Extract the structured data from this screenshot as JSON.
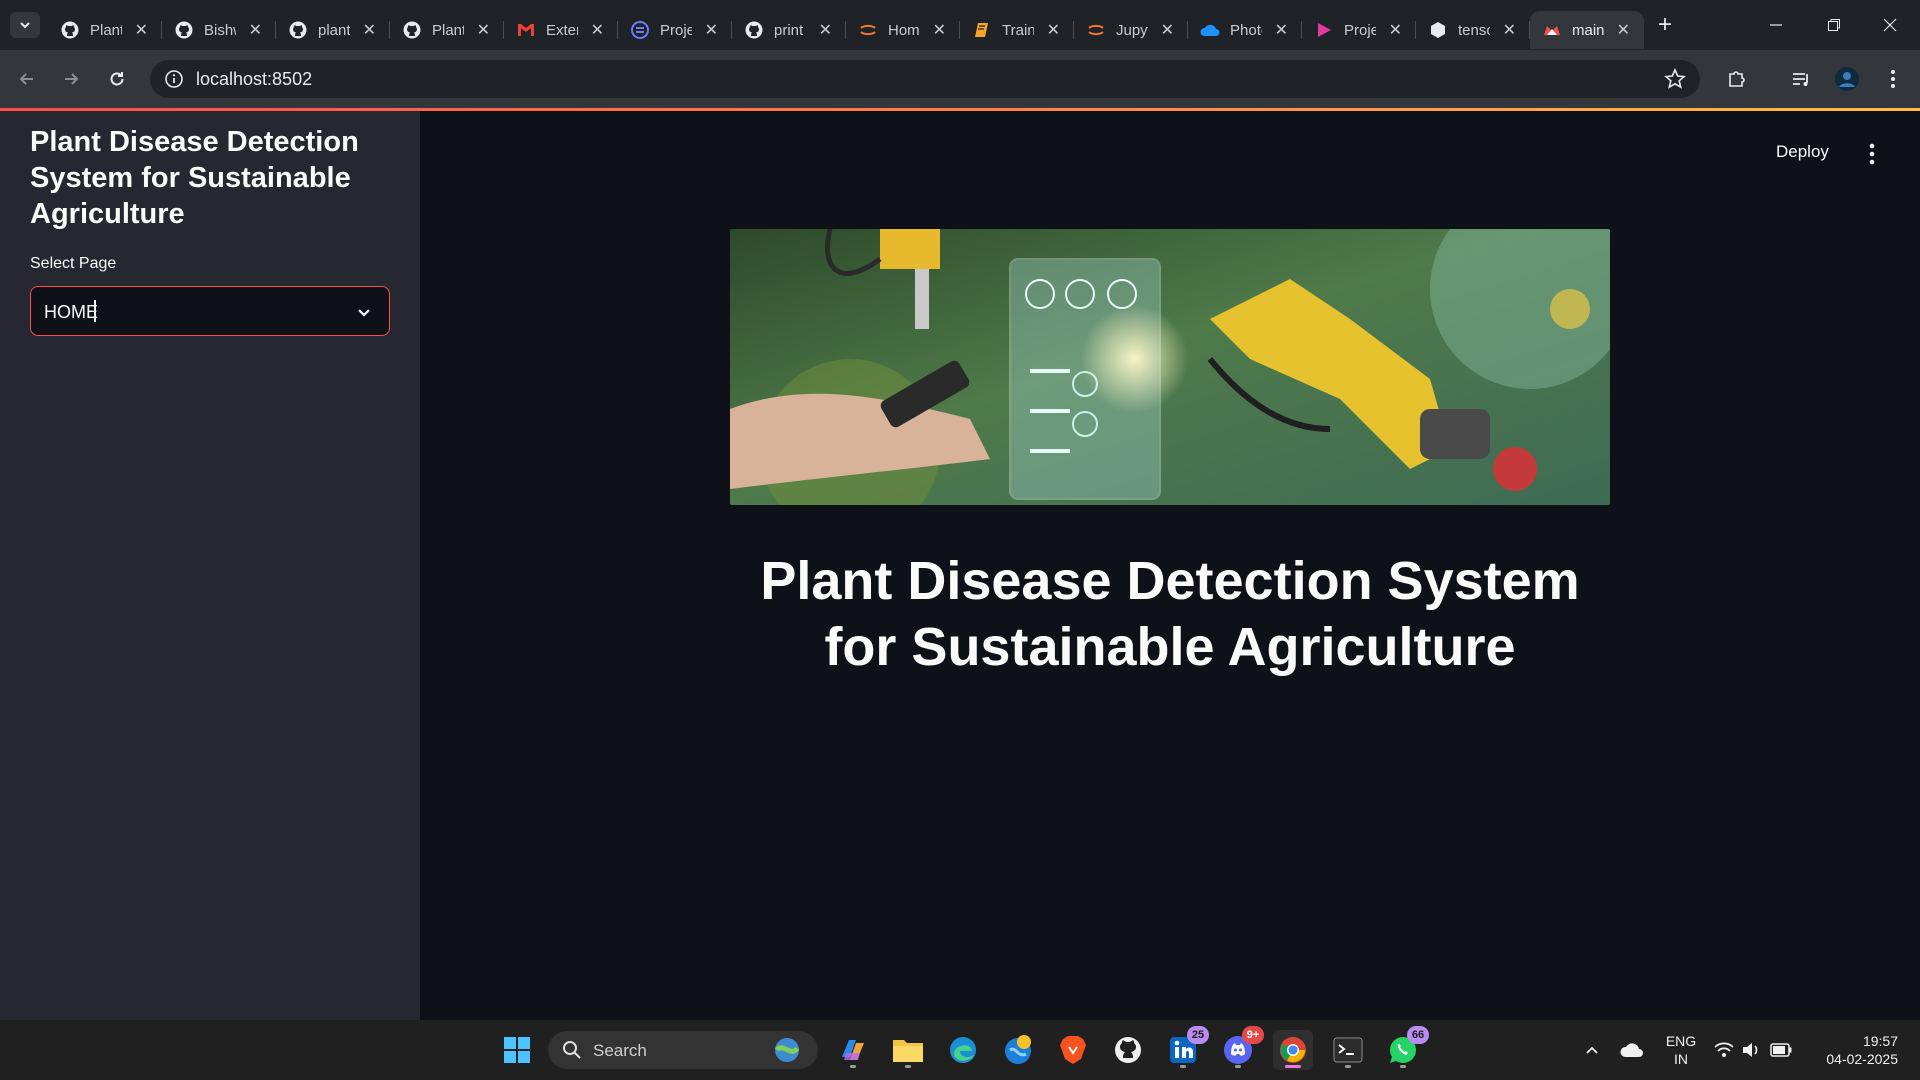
{
  "browser": {
    "tabs": [
      {
        "title": "Plant Disease",
        "icon": "github-icon"
      },
      {
        "title": "Bishwajit",
        "icon": "github-icon"
      },
      {
        "title": "plant-disease",
        "icon": "github-icon"
      },
      {
        "title": "Plant-Disease",
        "icon": "github-icon"
      },
      {
        "title": "External",
        "icon": "gmail-icon"
      },
      {
        "title": "Project",
        "icon": "project-icon"
      },
      {
        "title": "print",
        "icon": "github-icon"
      },
      {
        "title": "Home",
        "icon": "jupyter-icon"
      },
      {
        "title": "Training",
        "icon": "notebook-icon"
      },
      {
        "title": "Jupyter",
        "icon": "jupyter-icon"
      },
      {
        "title": "Photos",
        "icon": "cloud-icon"
      },
      {
        "title": "Project",
        "icon": "play-icon"
      },
      {
        "title": "tensorflow",
        "icon": "box-icon"
      },
      {
        "title": "main",
        "icon": "streamlit-icon"
      }
    ],
    "active_tab_index": 13,
    "url": "localhost:8502"
  },
  "sidebar": {
    "title": "Plant Disease Detection System for Sustainable Agriculture",
    "select_label": "Select Page",
    "select_value": "HOME"
  },
  "header": {
    "deploy_label": "Deploy"
  },
  "main": {
    "title": "Plant Disease Detection System for Sustainable Agriculture"
  },
  "taskbar": {
    "search_label": "Search",
    "linkedin_badge": "25",
    "discord_badge": "9+",
    "whatsapp_badge": "66",
    "lang_line1": "ENG",
    "lang_line2": "IN",
    "time": "19:57",
    "date": "04-02-2025"
  },
  "colors": {
    "accent": "#ff4b4b",
    "sidebar_bg": "#262730",
    "main_bg": "#0e1117"
  }
}
